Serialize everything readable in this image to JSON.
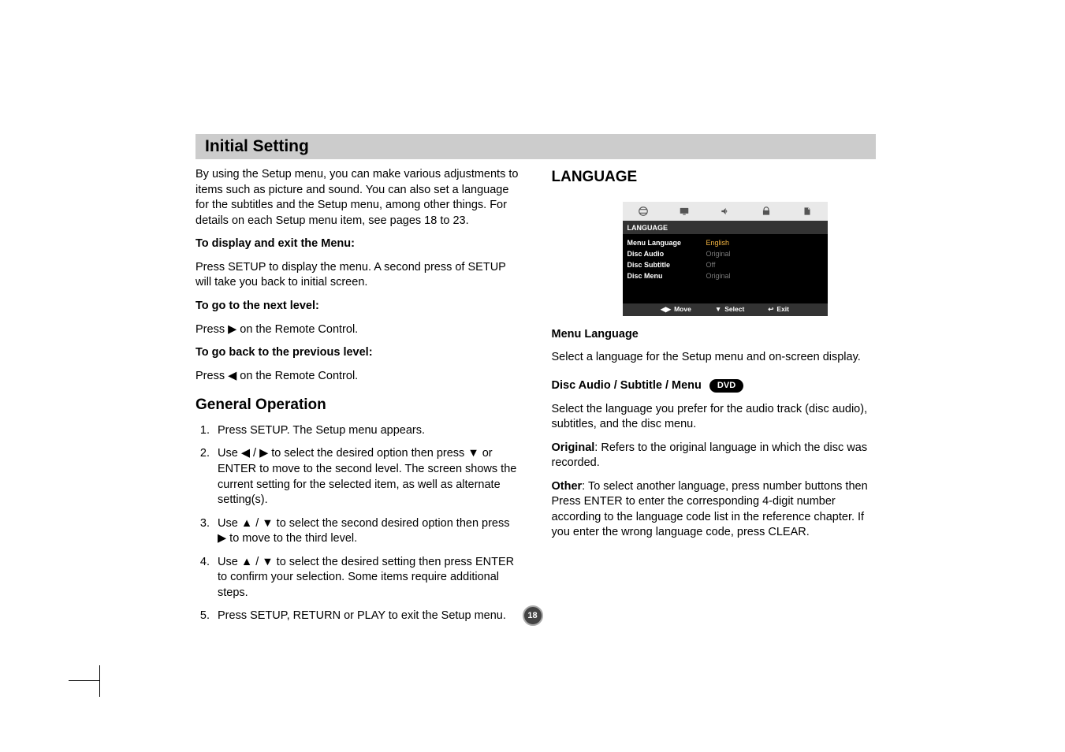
{
  "header": {
    "title": "Initial Setting"
  },
  "left": {
    "intro": "By using the Setup menu, you can make various adjustments to items such as picture and sound. You can also set a language for the subtitles and the Setup menu, among other things. For details on each Setup menu item, see pages 18 to 23.",
    "displayExit": {
      "title": "To display and exit the Menu:",
      "body": "Press SETUP to display the menu. A second press of SETUP will take you back to initial screen."
    },
    "nextLevel": {
      "title": "To go to the next level:",
      "body_pre": "Press ",
      "body_post": " on the Remote Control."
    },
    "prevLevel": {
      "title": "To go back to the previous level:",
      "body_pre": "Press ",
      "body_post": " on the Remote Control."
    },
    "generalOp": {
      "title": "General Operation",
      "steps": {
        "s1": "Press SETUP. The Setup menu appears.",
        "s2_pre": "Use ",
        "s2_mid": " to select the desired option then press ",
        "s2_post": " or ENTER to move to the second level. The screen shows the current setting for the selected item, as well as alternate setting(s).",
        "s3_pre": "Use ",
        "s3_mid": " to select the second desired option then press ",
        "s3_post": " to move to the third level.",
        "s4_pre": "Use ",
        "s4_post": " to select the desired setting then press ENTER to confirm your selection. Some items require additional steps.",
        "s5": "Press SETUP, RETURN or PLAY to exit the Setup menu."
      }
    }
  },
  "right": {
    "heading": "LANGUAGE",
    "menu": {
      "category": "LANGUAGE",
      "rows": {
        "r1": {
          "label": "Menu Language",
          "value": "English"
        },
        "r2": {
          "label": "Disc Audio",
          "value": "Original"
        },
        "r3": {
          "label": "Disc Subtitle",
          "value": "Off"
        },
        "r4": {
          "label": "Disc Menu",
          "value": "Original"
        }
      },
      "footer": {
        "move": "Move",
        "select": "Select",
        "exit": "Exit"
      }
    },
    "menuLanguage": {
      "title": "Menu Language",
      "body": "Select a language for the Setup menu and on-screen display."
    },
    "discASM": {
      "title": "Disc Audio / Subtitle / Menu",
      "badge": "DVD",
      "body": "Select the language you prefer for the audio track (disc audio), subtitles, and the disc menu."
    },
    "original": {
      "label": "Original",
      "body": ": Refers to the original language in which the disc was recorded."
    },
    "other": {
      "label": "Other",
      "body": ": To select another language, press number buttons then Press ENTER to enter the corresponding 4-digit number according to the language code list in the reference chapter. If you enter the wrong language code, press CLEAR."
    }
  },
  "pageNumber": "18"
}
